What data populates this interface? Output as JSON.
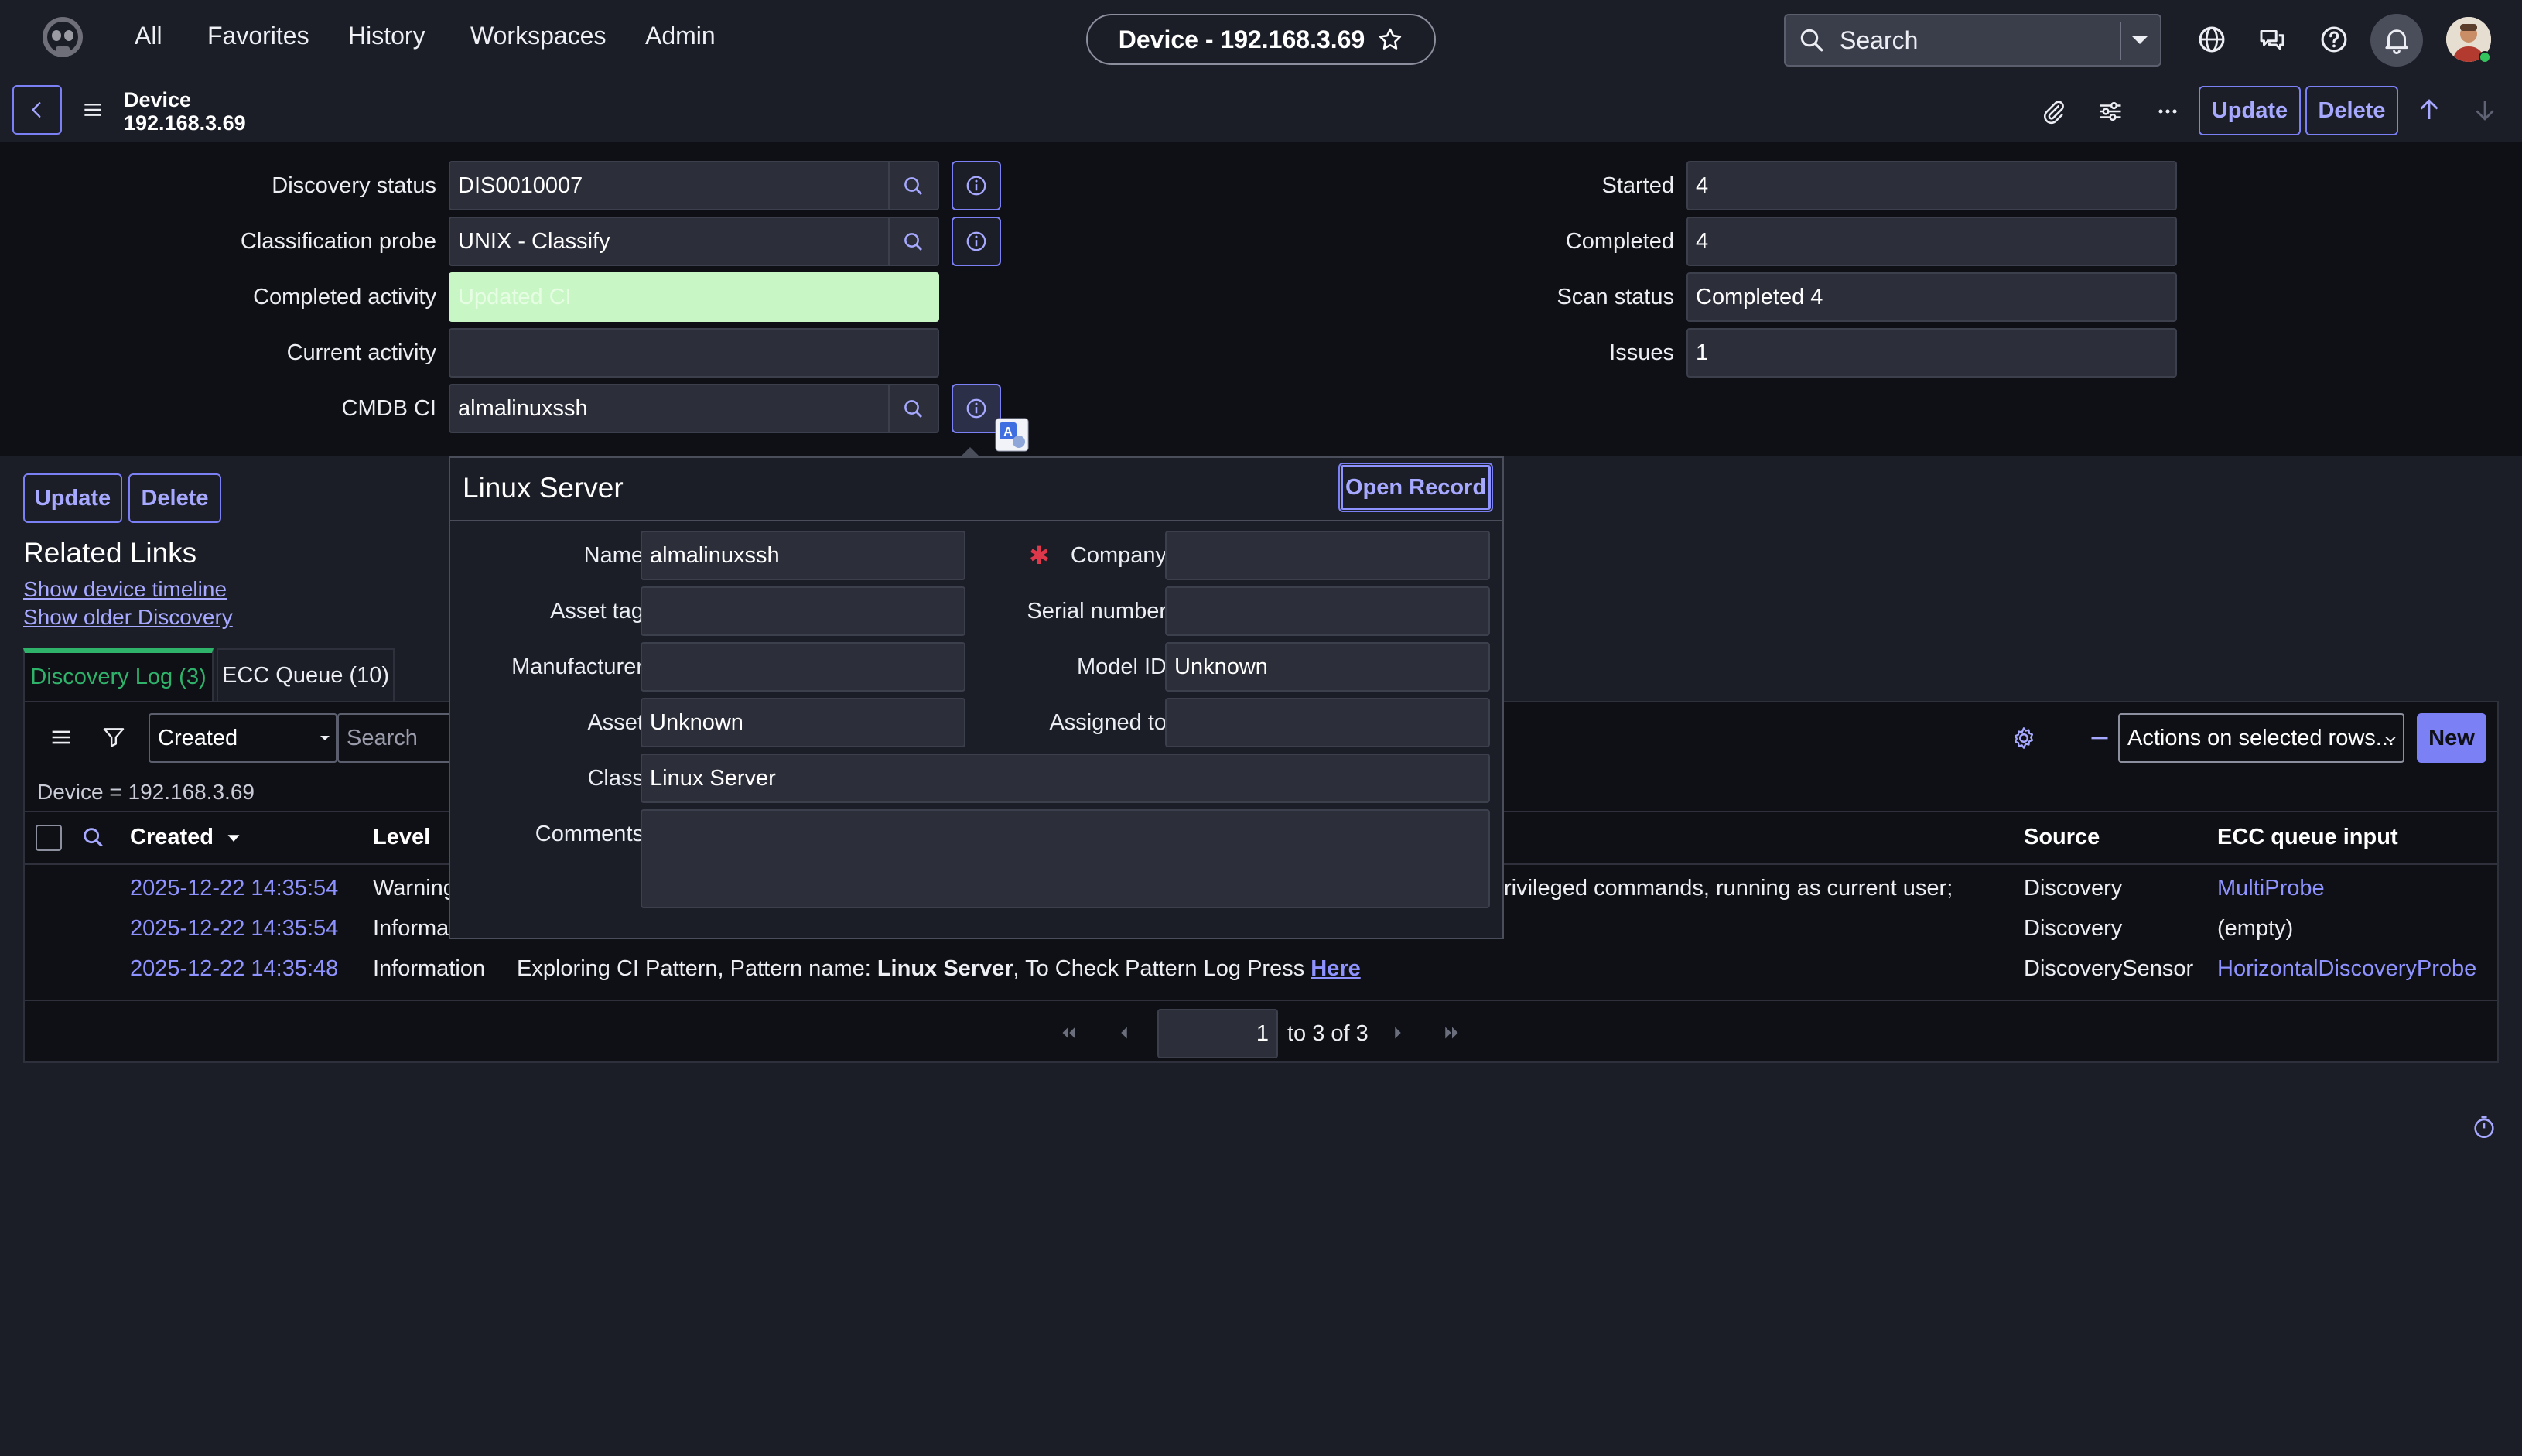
{
  "nav": {
    "links": [
      "All",
      "Favorites",
      "History",
      "Workspaces",
      "Admin"
    ],
    "record_pill": "Device - 192.168.3.69",
    "search_label": "Search"
  },
  "record": {
    "type": "Device",
    "name": "192.168.3.69",
    "update_label": "Update",
    "delete_label": "Delete"
  },
  "form": {
    "left": [
      {
        "label": "Discovery status",
        "value": "DIS0010007"
      },
      {
        "label": "Classification probe",
        "value": "UNIX - Classify"
      },
      {
        "label": "Completed activity",
        "value": "Updated CI"
      },
      {
        "label": "Current activity",
        "value": ""
      },
      {
        "label": "CMDB CI",
        "value": "almalinuxssh"
      }
    ],
    "right": [
      {
        "label": "Started",
        "value": "4"
      },
      {
        "label": "Completed",
        "value": "4"
      },
      {
        "label": "Scan status",
        "value": "Completed 4"
      },
      {
        "label": "Issues",
        "value": "1"
      }
    ]
  },
  "actions": {
    "update_label": "Update",
    "delete_label": "Delete"
  },
  "related": {
    "title": "Related Links",
    "links": [
      "Show device timeline",
      "Show older Discovery"
    ]
  },
  "tabs": [
    {
      "label": "Discovery Log (3)",
      "active": true
    },
    {
      "label": "ECC Queue (10)",
      "active": false
    }
  ],
  "list": {
    "field_select": "Created",
    "search_placeholder": "Search",
    "actions_select": "Actions on selected rows...",
    "new_label": "New",
    "filter_text": "Device = 192.168.3.69",
    "columns": {
      "created": "Created",
      "level": "Level",
      "source": "Source",
      "ecc": "ECC queue input"
    },
    "rows": [
      {
        "created": "2025-12-22 14:35:54",
        "level": "Warning",
        "message_tail": "rivileged commands, running as current user;",
        "source": "Discovery",
        "ecc": "MultiProbe",
        "ecc_link": true
      },
      {
        "created": "2025-12-22 14:35:54",
        "level": "Informa",
        "message_tail": "",
        "source": "Discovery",
        "ecc": "(empty)",
        "ecc_link": false
      },
      {
        "created": "2025-12-22 14:35:48",
        "level": "Information",
        "msg_pre": "Exploring CI Pattern, Pattern name: ",
        "msg_bold": "Linux Server",
        "msg_mid": ", To Check Pattern Log Press ",
        "msg_link": "Here",
        "source": "DiscoverySensor",
        "ecc": "HorizontalDiscoveryProbe",
        "ecc_link": true
      }
    ],
    "pagination": {
      "page": "1",
      "range": "to 3 of 3"
    }
  },
  "popup": {
    "title": "Linux Server",
    "open_record": "Open Record",
    "fields": {
      "name": {
        "label": "Name",
        "value": "almalinuxssh"
      },
      "company": {
        "label": "Company",
        "value": ""
      },
      "asset_tag": {
        "label": "Asset tag",
        "value": ""
      },
      "serial": {
        "label": "Serial number",
        "value": ""
      },
      "manufacturer": {
        "label": "Manufacturer",
        "value": ""
      },
      "model": {
        "label": "Model ID",
        "value": "Unknown"
      },
      "asset": {
        "label": "Asset",
        "value": "Unknown"
      },
      "assigned": {
        "label": "Assigned to",
        "value": ""
      },
      "class": {
        "label": "Class",
        "value": "Linux Server"
      },
      "comments": {
        "label": "Comments",
        "value": ""
      }
    }
  },
  "colors": {
    "accent": "#7c80f5",
    "success_field": "#c8f7c5",
    "active_tab": "#2fb36b",
    "mandatory": "#e0384b"
  }
}
